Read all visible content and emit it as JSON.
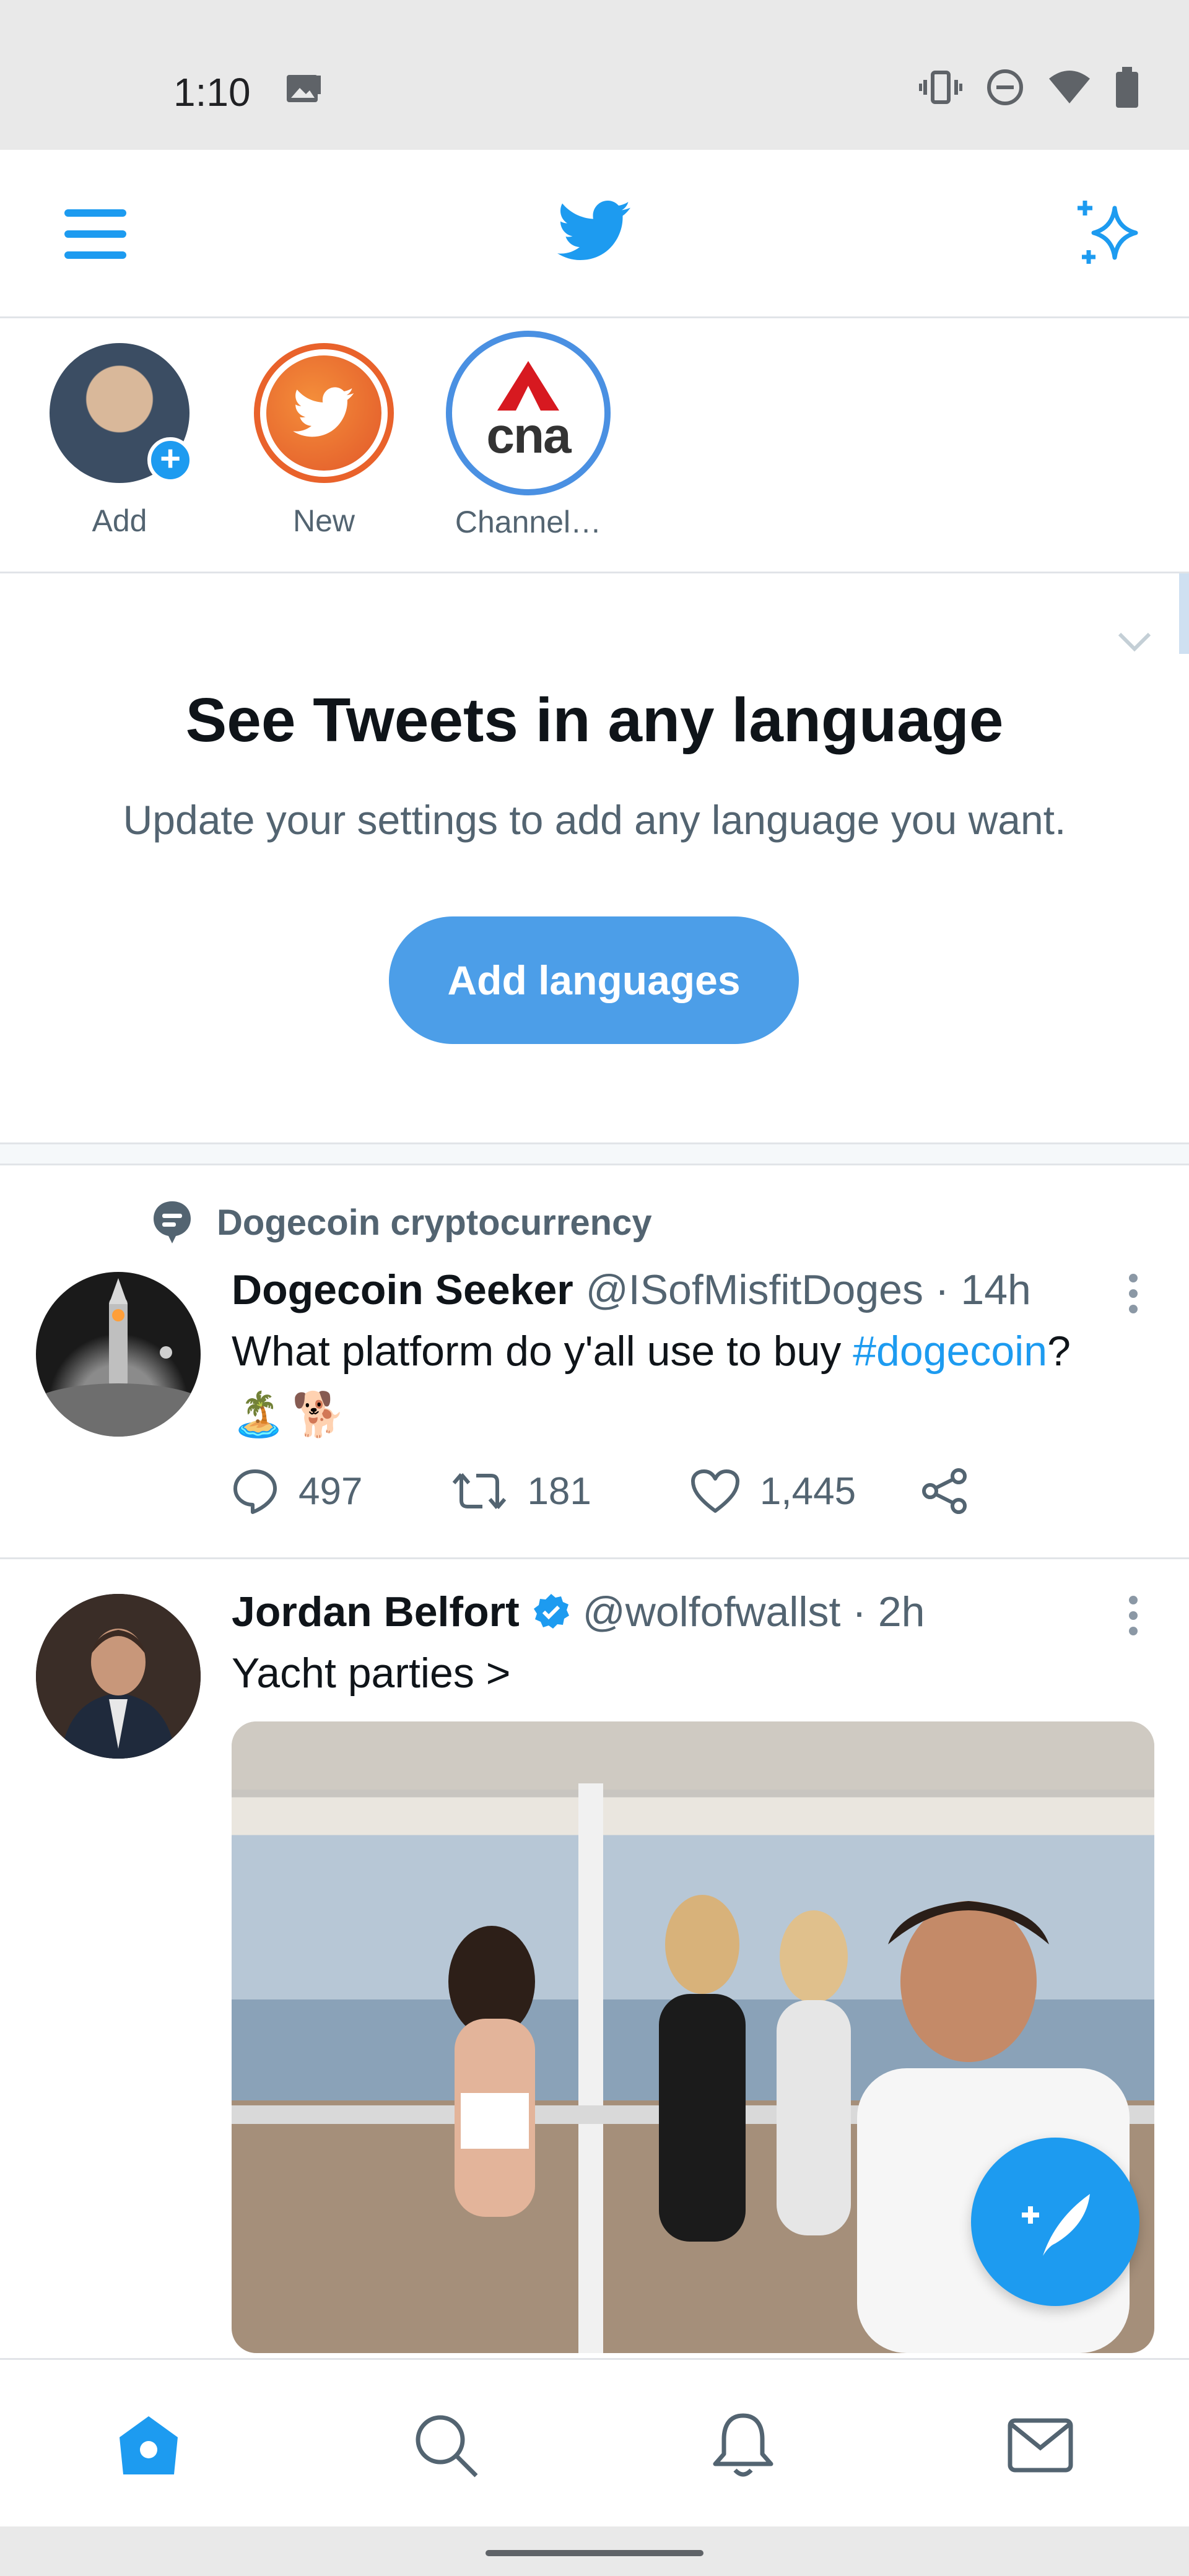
{
  "status_bar": {
    "time": "1:10"
  },
  "fleets": [
    {
      "label": "Add"
    },
    {
      "label": "New"
    },
    {
      "label": "Channel…",
      "logo_text": "cna"
    }
  ],
  "language_card": {
    "title": "See Tweets in any language",
    "subtitle": "Update your settings to add any language you want.",
    "button": "Add languages"
  },
  "tweets": [
    {
      "topic": "Dogecoin cryptocurrency",
      "author": "Dogecoin Seeker",
      "handle": "@ISofMisfitDoges · 14h",
      "text_before": "What platform do y'all use to buy ",
      "hashtag": "#dogecoin",
      "text_after": "?",
      "emojis": [
        "🏝️",
        "🐕"
      ],
      "replies": "497",
      "retweets": "181",
      "likes": "1,445"
    },
    {
      "author": "Jordan Belfort",
      "handle": "@wolfofwallst · 2h",
      "text": "Yacht parties >"
    }
  ],
  "colors": {
    "accent": "#1d9bf0",
    "button": "#4c9ee8",
    "muted_text": "#536471"
  },
  "icons": {
    "header": [
      "menu-icon",
      "twitter-bird-icon",
      "sparkle-icon"
    ],
    "nav": [
      "home-icon",
      "search-icon",
      "notifications-icon",
      "messages-icon"
    ]
  }
}
